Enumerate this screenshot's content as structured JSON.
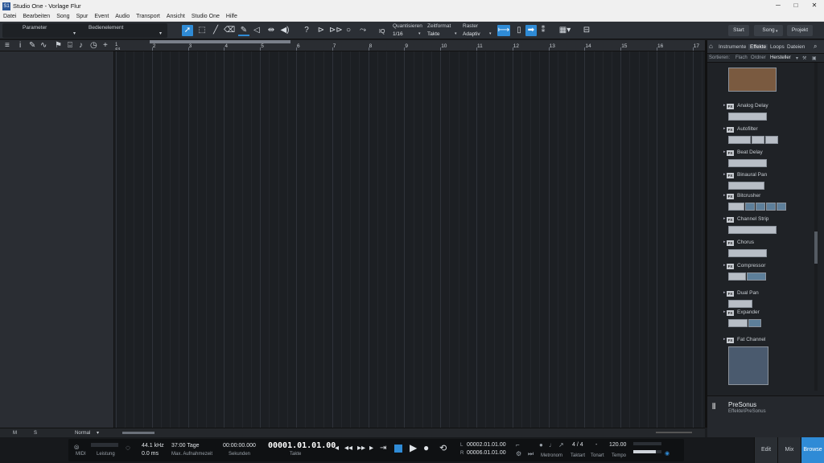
{
  "window": {
    "title": "Studio One - Vorlage Flur",
    "app_icon": "S1",
    "minimize": "─",
    "maximize": "□",
    "close": "✕"
  },
  "menu": [
    "Datei",
    "Bearbeiten",
    "Song",
    "Spur",
    "Event",
    "Audio",
    "Transport",
    "Ansicht",
    "Studio One",
    "Hilfe"
  ],
  "toolbar": {
    "parameter_label": "Parameter",
    "control_label": "Bedienelement",
    "quantize_label": "Quantisieren",
    "quantize_value": "1/16",
    "timeformat_label": "Zeitformat",
    "timeformat_value": "Takte",
    "grid_label": "Raster",
    "grid_value": "Adaptiv",
    "iq_label": "IQ",
    "help_icon": "?",
    "nav": {
      "start": "Start",
      "song": "Song",
      "project": "Projekt"
    }
  },
  "ruler": {
    "first_marker": "1",
    "signature": "4/4",
    "bars": [
      "2",
      "3",
      "4",
      "5",
      "6",
      "7",
      "8",
      "9",
      "10",
      "11",
      "12",
      "13",
      "14",
      "15",
      "16",
      "17"
    ]
  },
  "browser": {
    "tabs": {
      "instruments": "Instrumente",
      "effects": "Effekte",
      "loops": "Loops",
      "files": "Dateien"
    },
    "sort": {
      "label": "Sortieren:",
      "flat": "Flach",
      "folder": "Ordner",
      "vendor": "Hersteller"
    },
    "fx_badge": "FX",
    "effects": [
      "Analog Delay",
      "Autofilter",
      "Beat Delay",
      "Binaural Pan",
      "Bitcrusher",
      "Channel Strip",
      "Chorus",
      "Compressor",
      "Dual Pan",
      "Expander",
      "Fat Channel"
    ],
    "footer_title": "PreSonus",
    "footer_path": "Effekte\\PreSonus"
  },
  "bottom_strip": {
    "m": "M",
    "s": "S",
    "mode": "Normal"
  },
  "transport": {
    "midi_label": "MIDI",
    "perf_label": "Leistung",
    "samplerate": "44.1 kHz",
    "latency": "0.0 ms",
    "rec_time": "37:00 Tage",
    "rec_time_label": "Max. Aufnahmezeit",
    "seconds": "00:00:00.000",
    "seconds_label": "Sekunden",
    "position": "00001.01.01.00",
    "position_label": "Takte",
    "loop_l_label": "L",
    "loop_l": "00002.01.01.00",
    "loop_r_label": "R",
    "loop_r": "00006.01.01.00",
    "metronome_label": "Metronom",
    "timesig": "4 / 4",
    "timesig_label": "Taktart",
    "key": "-",
    "key_label": "Tonart",
    "tempo": "120.00",
    "tempo_label": "Tempo"
  },
  "views": {
    "edit": "Edit",
    "mix": "Mix",
    "browse": "Browse"
  },
  "colors": {
    "accent": "#2f8bd6",
    "background": "#1c1f23"
  }
}
